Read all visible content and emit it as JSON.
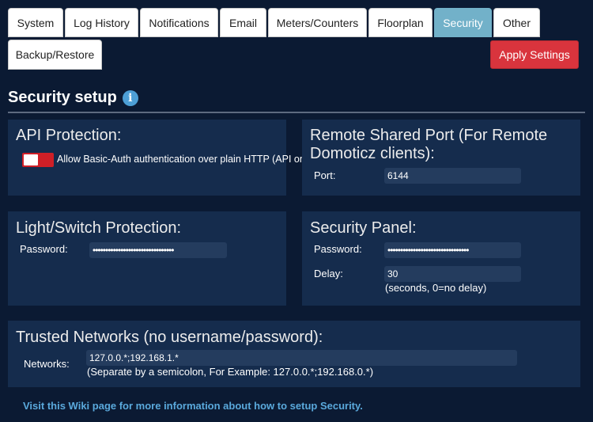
{
  "tabs": [
    {
      "label": "System"
    },
    {
      "label": "Log History"
    },
    {
      "label": "Notifications"
    },
    {
      "label": "Email"
    },
    {
      "label": "Meters/Counters"
    },
    {
      "label": "Floorplan"
    },
    {
      "label": "Security",
      "active": true
    },
    {
      "label": "Other"
    },
    {
      "label": "Backup/Restore"
    }
  ],
  "apply_label": "Apply Settings",
  "page_title": "Security setup",
  "api": {
    "title": "API Protection:",
    "checkbox_label": "Allow Basic-Auth authentication over plain HTTP (API only)."
  },
  "remote": {
    "title": "Remote Shared Port (For Remote Domoticz clients):",
    "port_label": "Port:",
    "port_value": "6144"
  },
  "light": {
    "title": "Light/Switch Protection:",
    "password_label": "Password:",
    "password_value": "••••••••••••••••••••••••••••••••"
  },
  "security_panel": {
    "title": "Security Panel:",
    "password_label": "Password:",
    "password_value": "••••••••••••••••••••••••••••••••",
    "delay_label": "Delay:",
    "delay_value": "30",
    "delay_hint": "(seconds, 0=no delay)"
  },
  "trusted": {
    "title": "Trusted Networks (no username/password):",
    "networks_label": "Networks:",
    "networks_value": "127.0.0.*;192.168.1.*",
    "hint": "(Separate by a semicolon, For Example: 127.0.0.*;192.168.0.*)"
  },
  "wiki_link": "Visit this Wiki page for more information about how to setup Security.",
  "colors": {
    "background": "#0b1a33",
    "panel": "#152c4d",
    "active_tab": "#72b1c9",
    "apply": "#d9343d",
    "link": "#5aa9dc"
  }
}
